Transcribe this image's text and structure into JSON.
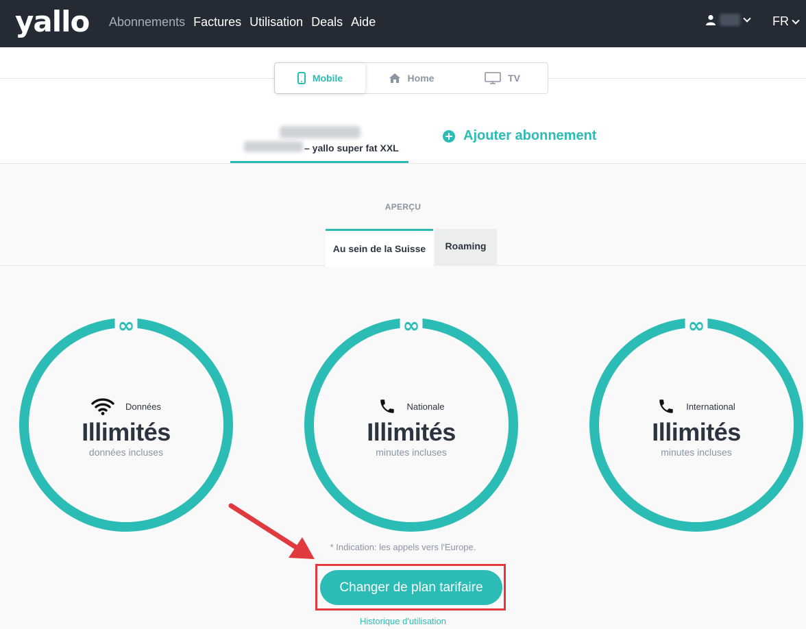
{
  "header": {
    "logo": "yallo",
    "nav": [
      "Abonnements",
      "Factures",
      "Utilisation",
      "Deals",
      "Aide"
    ],
    "language": "FR"
  },
  "service_tabs": [
    {
      "label": "Mobile",
      "icon": "smartphone-icon"
    },
    {
      "label": "Home",
      "icon": "house-icon"
    },
    {
      "label": "TV",
      "icon": "monitor-icon"
    }
  ],
  "subscription": {
    "plan": "– yallo super fat XXL"
  },
  "add_subscription": "Ajouter abonnement",
  "overview_title": "APERÇU",
  "region_tabs": [
    "Au sein de la Suisse",
    "Roaming"
  ],
  "gauges": [
    {
      "label": "Données",
      "icon": "wifi-icon",
      "value": "Illimités",
      "sub": "données incluses"
    },
    {
      "label": "Nationale",
      "icon": "phone-icon",
      "value": "Illimités",
      "sub": "minutes incluses"
    },
    {
      "label": "International",
      "icon": "phone-icon",
      "value": "Illimités",
      "sub": "minutes incluses"
    }
  ],
  "infinity_symbol": "∞",
  "note": "* Indication: les appels vers l'Europe.",
  "change_plan_button": "Changer de plan tarifaire",
  "usage_history_link": "Historique d'utilisation",
  "colors": {
    "accent": "#2bbcb6",
    "header": "#242b35",
    "highlight": "#e0393e"
  }
}
